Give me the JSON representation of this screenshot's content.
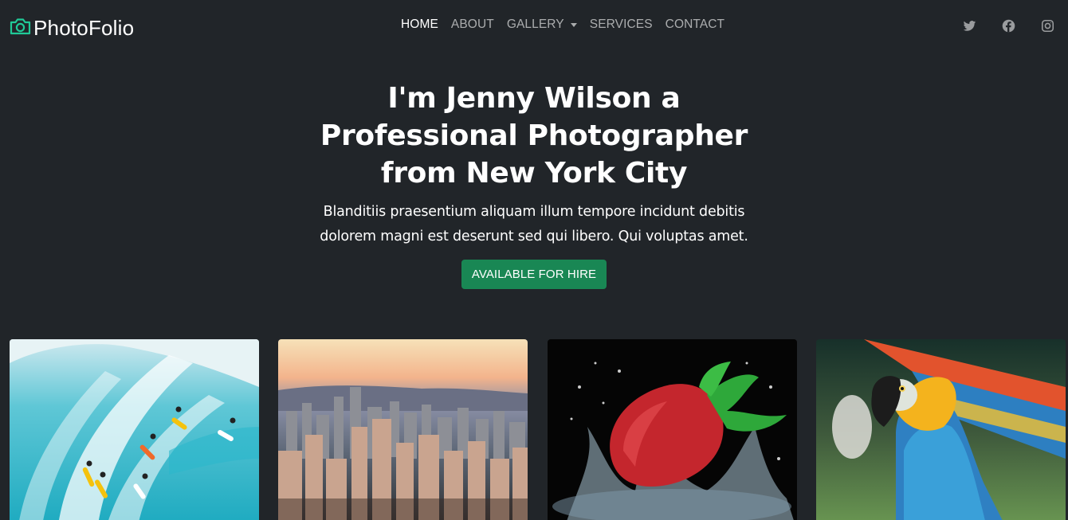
{
  "brand": {
    "name": "PhotoFolio",
    "icon": "camera-icon",
    "accent_color": "#20c997"
  },
  "nav": {
    "items": [
      {
        "label": "HOME",
        "active": true
      },
      {
        "label": "ABOUT",
        "active": false
      },
      {
        "label": "GALLERY",
        "active": false,
        "dropdown": true
      },
      {
        "label": "SERVICES",
        "active": false
      },
      {
        "label": "CONTACT",
        "active": false
      }
    ]
  },
  "social": [
    "twitter-icon",
    "facebook-icon",
    "instagram-icon"
  ],
  "hero": {
    "title_line1": "I'm Jenny Wilson a",
    "title_line2": "Professional Photographer",
    "title_line3": "from New York City",
    "text_line1": "Blanditiis praesentium aliquam illum tempore incidunt debitis",
    "text_line2": "dolorem magni est deserunt sed qui libero. Qui voluptas amet.",
    "button_label": "AVAILABLE FOR HIRE",
    "button_color": "#198754"
  },
  "gallery": {
    "photos": [
      "surfers-photo",
      "city-skyline-photo",
      "strawberry-splash-photo",
      "macaw-parrot-photo"
    ]
  }
}
